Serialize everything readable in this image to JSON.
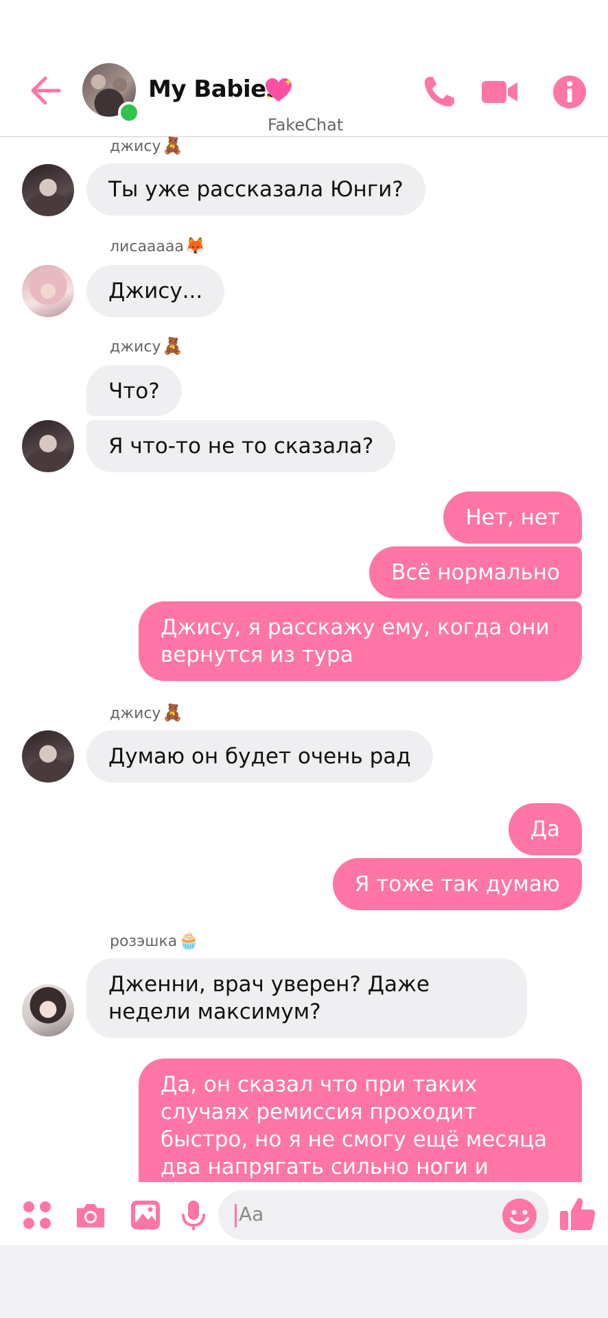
{
  "header": {
    "title": "My Babies",
    "title_emoji": "sparkling-heart",
    "watermark": "FakeChat"
  },
  "colors": {
    "accent": "#ff75a5",
    "incoming_bubble": "#efeff2",
    "online": "#31c24d"
  },
  "messages": [
    {
      "type": "sender",
      "text": "джису",
      "emoji": "🧸"
    },
    {
      "type": "in",
      "avatar": "jisoo",
      "text": "Ты уже рассказала Юнги?"
    },
    {
      "type": "sender",
      "text": "лисааааа",
      "emoji": "🦊"
    },
    {
      "type": "in",
      "avatar": "lisa",
      "text": "Джису..."
    },
    {
      "type": "sender",
      "text": "джису",
      "emoji": "🧸"
    },
    {
      "type": "in",
      "text": "Что?"
    },
    {
      "type": "in",
      "avatar": "jisoo",
      "text": "Я что-то не то сказала?"
    },
    {
      "type": "out",
      "text": "Нет, нет"
    },
    {
      "type": "out",
      "text": "Всё нормально"
    },
    {
      "type": "out",
      "text": "Джису, я расскажу ему, когда они вернутся из тура"
    },
    {
      "type": "sender",
      "text": "джису",
      "emoji": "🧸"
    },
    {
      "type": "in",
      "avatar": "jisoo",
      "text": "Думаю он будет очень рад"
    },
    {
      "type": "out",
      "text": "Да"
    },
    {
      "type": "out",
      "text": "Я тоже так думаю"
    },
    {
      "type": "sender",
      "text": "розэшка",
      "emoji": "🧁"
    },
    {
      "type": "in",
      "avatar": "rose",
      "text": "Дженни, врач уверен? Даже недели максимум?"
    },
    {
      "type": "out",
      "text": "Да, он сказал что при таких случаях ремиссия проходит быстро,  но я не смогу ещё месяца два напрягать сильно ноги и спину"
    }
  ],
  "composer": {
    "placeholder": "Aa",
    "icons": [
      "apps-icon",
      "camera-icon",
      "image-icon",
      "microphone-icon",
      "emoji-icon",
      "thumbs-up-icon"
    ]
  }
}
